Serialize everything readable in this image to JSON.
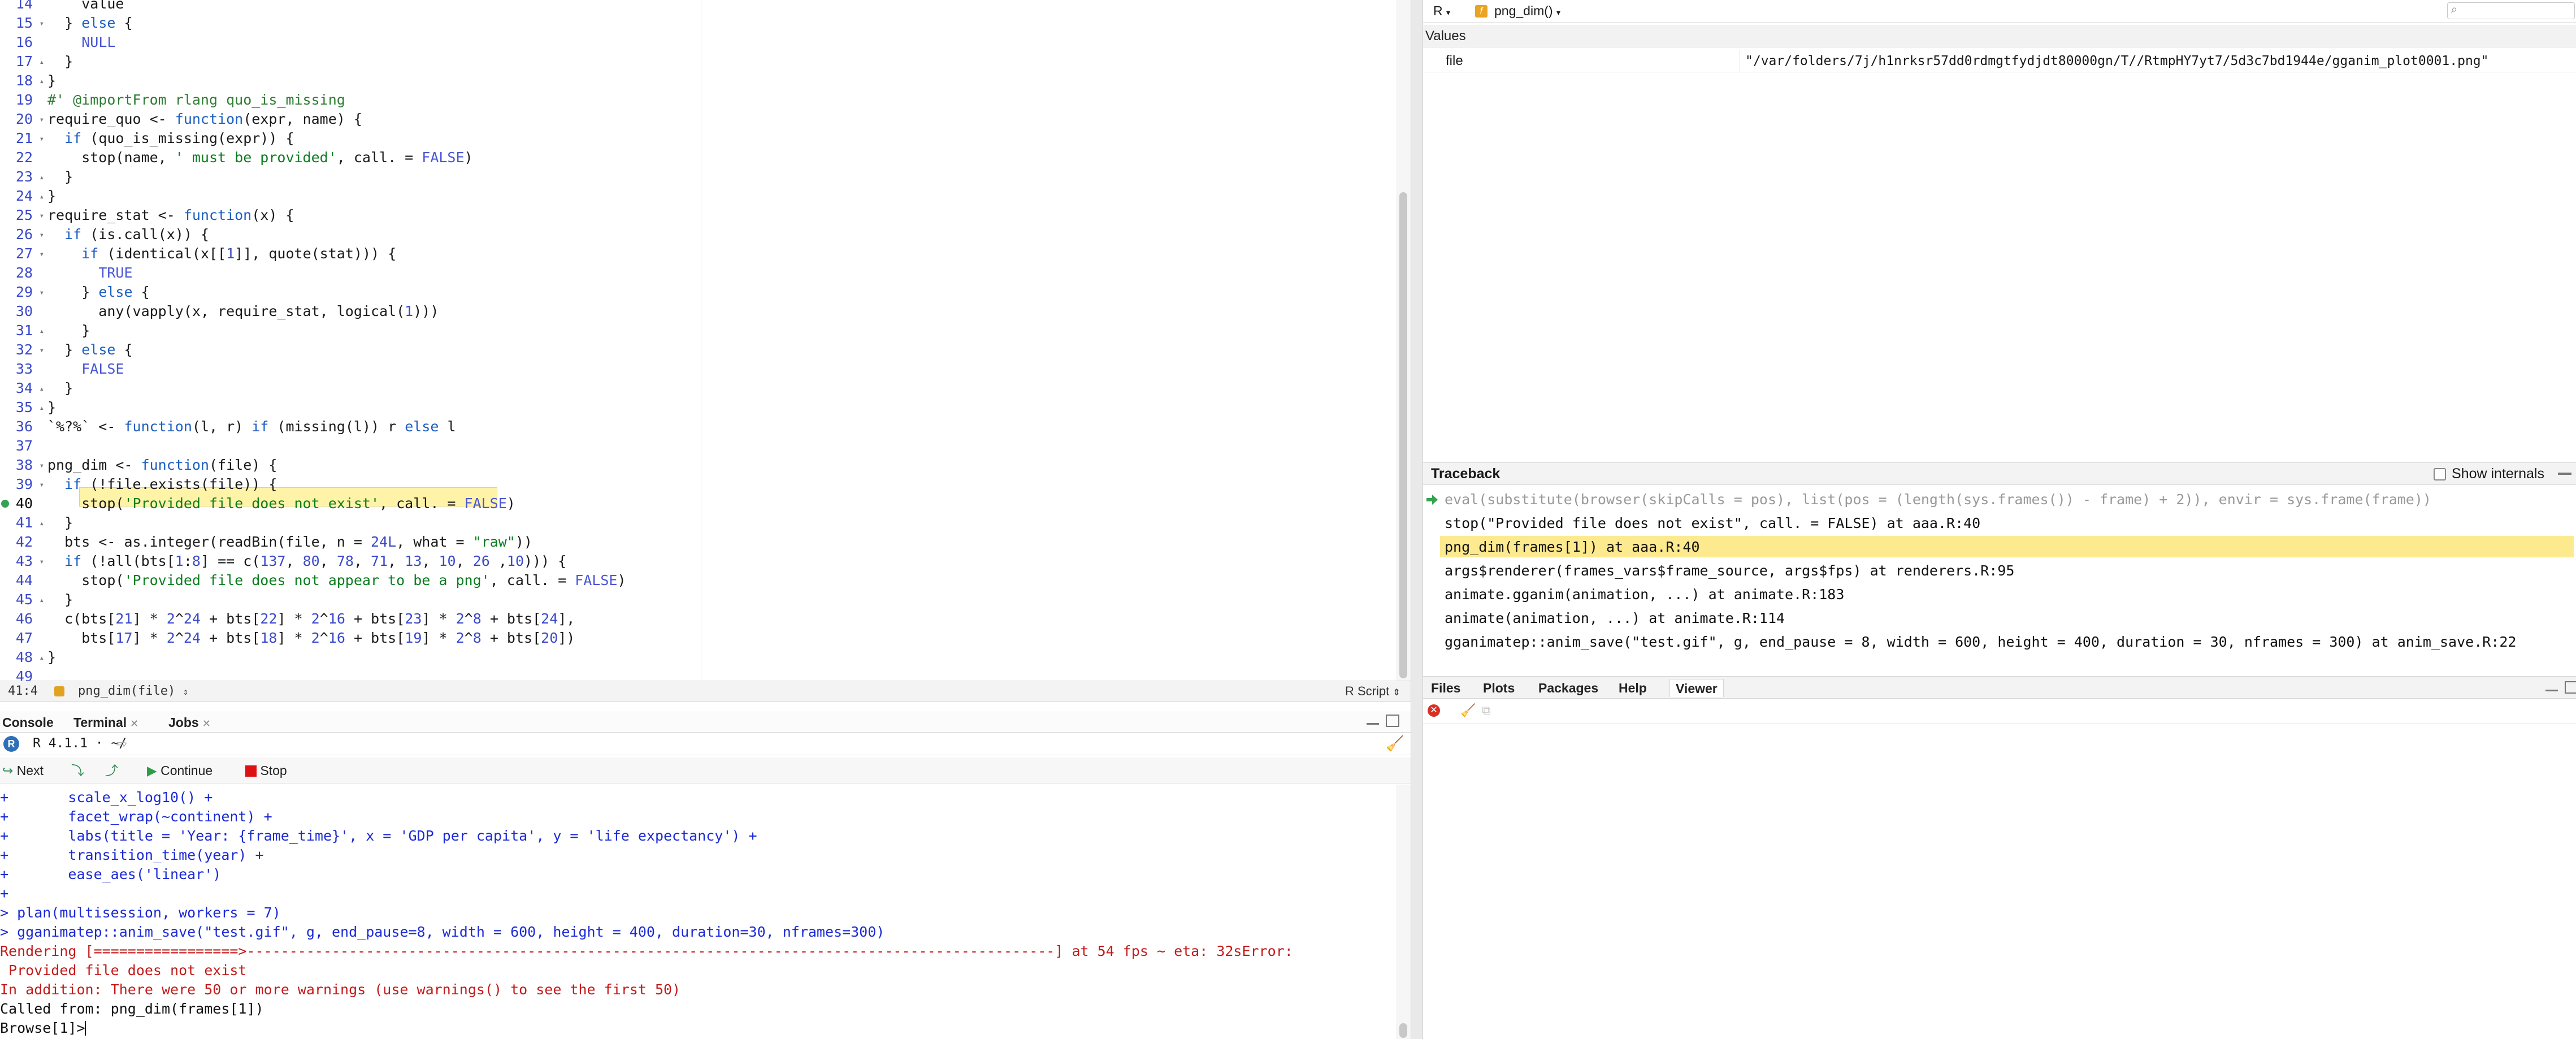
{
  "editor": {
    "lines": [
      {
        "n": "14",
        "fold": "",
        "code": [
          [
            "    value",
            "fn"
          ]
        ]
      },
      {
        "n": "15",
        "fold": "▾",
        "code": [
          [
            "  } ",
            "fn"
          ],
          [
            "else",
            "kw"
          ],
          [
            " {",
            "fn"
          ]
        ]
      },
      {
        "n": "16",
        "fold": "",
        "code": [
          [
            "    ",
            "fn"
          ],
          [
            "NULL",
            "lit"
          ]
        ]
      },
      {
        "n": "17",
        "fold": "▴",
        "code": [
          [
            "  }",
            "fn"
          ]
        ]
      },
      {
        "n": "18",
        "fold": "▴",
        "code": [
          [
            "}",
            "fn"
          ]
        ]
      },
      {
        "n": "19",
        "fold": "",
        "code": [
          [
            "#' @importFrom ",
            "comment"
          ],
          [
            "rlang quo_is_missing",
            "comment"
          ]
        ]
      },
      {
        "n": "20",
        "fold": "▾",
        "code": [
          [
            "require_quo <- ",
            "fn"
          ],
          [
            "function",
            "kw"
          ],
          [
            "(expr, name) {",
            "fn"
          ]
        ]
      },
      {
        "n": "21",
        "fold": "▾",
        "code": [
          [
            "  ",
            "fn"
          ],
          [
            "if",
            "kw"
          ],
          [
            " (quo_is_missing(expr)) {",
            "fn"
          ]
        ]
      },
      {
        "n": "22",
        "fold": "",
        "code": [
          [
            "    stop(name, ",
            "fn"
          ],
          [
            "' must be provided'",
            "str"
          ],
          [
            ", call. = ",
            "fn"
          ],
          [
            "FALSE",
            "lit"
          ],
          [
            ")",
            "fn"
          ]
        ]
      },
      {
        "n": "23",
        "fold": "▴",
        "code": [
          [
            "  }",
            "fn"
          ]
        ]
      },
      {
        "n": "24",
        "fold": "▴",
        "code": [
          [
            "}",
            "fn"
          ]
        ]
      },
      {
        "n": "25",
        "fold": "▾",
        "code": [
          [
            "require_stat <- ",
            "fn"
          ],
          [
            "function",
            "kw"
          ],
          [
            "(x) {",
            "fn"
          ]
        ]
      },
      {
        "n": "26",
        "fold": "▾",
        "code": [
          [
            "  ",
            "fn"
          ],
          [
            "if",
            "kw"
          ],
          [
            " (is.call(x)) {",
            "fn"
          ]
        ]
      },
      {
        "n": "27",
        "fold": "▾",
        "code": [
          [
            "    ",
            "fn"
          ],
          [
            "if",
            "kw"
          ],
          [
            " (identical(x[[",
            "fn"
          ],
          [
            "1",
            "num"
          ],
          [
            "]], quote(stat))) {",
            "fn"
          ]
        ]
      },
      {
        "n": "28",
        "fold": "",
        "code": [
          [
            "      ",
            "fn"
          ],
          [
            "TRUE",
            "lit"
          ]
        ]
      },
      {
        "n": "29",
        "fold": "▾",
        "code": [
          [
            "    } ",
            "fn"
          ],
          [
            "else",
            "kw"
          ],
          [
            " {",
            "fn"
          ]
        ]
      },
      {
        "n": "30",
        "fold": "",
        "code": [
          [
            "      any(vapply(x, require_stat, logical(",
            "fn"
          ],
          [
            "1",
            "num"
          ],
          [
            ")))",
            "fn"
          ]
        ]
      },
      {
        "n": "31",
        "fold": "▴",
        "code": [
          [
            "    }",
            "fn"
          ]
        ]
      },
      {
        "n": "32",
        "fold": "▾",
        "code": [
          [
            "  } ",
            "fn"
          ],
          [
            "else",
            "kw"
          ],
          [
            " {",
            "fn"
          ]
        ]
      },
      {
        "n": "33",
        "fold": "",
        "code": [
          [
            "    ",
            "fn"
          ],
          [
            "FALSE",
            "lit"
          ]
        ]
      },
      {
        "n": "34",
        "fold": "▴",
        "code": [
          [
            "  }",
            "fn"
          ]
        ]
      },
      {
        "n": "35",
        "fold": "▴",
        "code": [
          [
            "}",
            "fn"
          ]
        ]
      },
      {
        "n": "36",
        "fold": "",
        "code": [
          [
            "`%?%` <- ",
            "fn"
          ],
          [
            "function",
            "kw"
          ],
          [
            "(l, r) ",
            "fn"
          ],
          [
            "if",
            "kw"
          ],
          [
            " (missing(l)) r ",
            "fn"
          ],
          [
            "else",
            "kw"
          ],
          [
            " l",
            "fn"
          ]
        ]
      },
      {
        "n": "37",
        "fold": "",
        "code": []
      },
      {
        "n": "38",
        "fold": "▾",
        "code": [
          [
            "png_dim <- ",
            "fn"
          ],
          [
            "function",
            "kw"
          ],
          [
            "(file) {",
            "fn"
          ]
        ]
      },
      {
        "n": "39",
        "fold": "▾",
        "code": [
          [
            "  ",
            "fn"
          ],
          [
            "if",
            "kw"
          ],
          [
            " (!file.exists(file)) {",
            "fn"
          ]
        ]
      },
      {
        "n": "40",
        "fold": "",
        "code": [
          [
            "    stop(",
            "fn"
          ],
          [
            "'Provided file does not exist'",
            "str"
          ],
          [
            ", call. = ",
            "fn"
          ],
          [
            "FALSE",
            "lit"
          ],
          [
            ")",
            "fn"
          ]
        ]
      },
      {
        "n": "41",
        "fold": "▴",
        "code": [
          [
            "  }",
            "fn"
          ]
        ]
      },
      {
        "n": "42",
        "fold": "",
        "code": [
          [
            "  bts <- as.integer(readBin(file, n = ",
            "fn"
          ],
          [
            "24L",
            "num"
          ],
          [
            ", what = ",
            "fn"
          ],
          [
            "\"raw\"",
            "str"
          ],
          [
            "))",
            "fn"
          ]
        ]
      },
      {
        "n": "43",
        "fold": "▾",
        "code": [
          [
            "  ",
            "fn"
          ],
          [
            "if",
            "kw"
          ],
          [
            " (!all(bts[",
            "fn"
          ],
          [
            "1",
            "num"
          ],
          [
            ":",
            "fn"
          ],
          [
            "8",
            "num"
          ],
          [
            "] == c(",
            "fn"
          ],
          [
            "137",
            "num"
          ],
          [
            ", ",
            "fn"
          ],
          [
            "80",
            "num"
          ],
          [
            ", ",
            "fn"
          ],
          [
            "78",
            "num"
          ],
          [
            ", ",
            "fn"
          ],
          [
            "71",
            "num"
          ],
          [
            ", ",
            "fn"
          ],
          [
            "13",
            "num"
          ],
          [
            ", ",
            "fn"
          ],
          [
            "10",
            "num"
          ],
          [
            ", ",
            "fn"
          ],
          [
            "26",
            "num"
          ],
          [
            " ,",
            "fn"
          ],
          [
            "10",
            "num"
          ],
          [
            "))) {",
            "fn"
          ]
        ]
      },
      {
        "n": "44",
        "fold": "",
        "code": [
          [
            "    stop(",
            "fn"
          ],
          [
            "'Provided file does not appear to be a png'",
            "str"
          ],
          [
            ", call. = ",
            "fn"
          ],
          [
            "FALSE",
            "lit"
          ],
          [
            ")",
            "fn"
          ]
        ]
      },
      {
        "n": "45",
        "fold": "▴",
        "code": [
          [
            "  }",
            "fn"
          ]
        ]
      },
      {
        "n": "46",
        "fold": "",
        "code": [
          [
            "  c(bts[",
            "fn"
          ],
          [
            "21",
            "num"
          ],
          [
            "] * ",
            "fn"
          ],
          [
            "2",
            "num"
          ],
          [
            "^",
            "fn"
          ],
          [
            "24",
            "num"
          ],
          [
            " + bts[",
            "fn"
          ],
          [
            "22",
            "num"
          ],
          [
            "] * ",
            "fn"
          ],
          [
            "2",
            "num"
          ],
          [
            "^",
            "fn"
          ],
          [
            "16",
            "num"
          ],
          [
            " + bts[",
            "fn"
          ],
          [
            "23",
            "num"
          ],
          [
            "] * ",
            "fn"
          ],
          [
            "2",
            "num"
          ],
          [
            "^",
            "fn"
          ],
          [
            "8",
            "num"
          ],
          [
            " + bts[",
            "fn"
          ],
          [
            "24",
            "num"
          ],
          [
            "],",
            "fn"
          ]
        ]
      },
      {
        "n": "47",
        "fold": "",
        "code": [
          [
            "    bts[",
            "fn"
          ],
          [
            "17",
            "num"
          ],
          [
            "] * ",
            "fn"
          ],
          [
            "2",
            "num"
          ],
          [
            "^",
            "fn"
          ],
          [
            "24",
            "num"
          ],
          [
            " + bts[",
            "fn"
          ],
          [
            "18",
            "num"
          ],
          [
            "] * ",
            "fn"
          ],
          [
            "2",
            "num"
          ],
          [
            "^",
            "fn"
          ],
          [
            "16",
            "num"
          ],
          [
            " + bts[",
            "fn"
          ],
          [
            "19",
            "num"
          ],
          [
            "] * ",
            "fn"
          ],
          [
            "2",
            "num"
          ],
          [
            "^",
            "fn"
          ],
          [
            "8",
            "num"
          ],
          [
            " + bts[",
            "fn"
          ],
          [
            "20",
            "num"
          ],
          [
            "])",
            "fn"
          ]
        ]
      },
      {
        "n": "48",
        "fold": "▴",
        "code": [
          [
            "}",
            "fn"
          ]
        ]
      },
      {
        "n": "49",
        "fold": "",
        "code": []
      }
    ],
    "current_line": "40"
  },
  "statusbar": {
    "position": "41:4",
    "function": "png_dim(file)",
    "file_type": "R Script"
  },
  "console": {
    "tabs": [
      "Console",
      "Terminal",
      "Jobs"
    ],
    "r_version": "R 4.1.1 · ~/",
    "debug_buttons": {
      "next": "Next",
      "continue": "Continue",
      "stop": "Stop"
    },
    "lines": [
      {
        "text": "+       scale_x_log10() +",
        "color": "blue"
      },
      {
        "text": "+       facet_wrap(~continent) +",
        "color": "blue"
      },
      {
        "text": "+       labs(title = 'Year: {frame_time}', x = 'GDP per capita', y = 'life expectancy') +",
        "color": "blue"
      },
      {
        "text": "+       transition_time(year) +",
        "color": "blue"
      },
      {
        "text": "+       ease_aes('linear')",
        "color": "blue"
      },
      {
        "text": "+",
        "color": "blue"
      },
      {
        "text": "> plan(multisession, workers = 7)",
        "color": "blue"
      },
      {
        "text": "> gganimatep::anim_save(\"test.gif\", g, end_pause=8, width = 600, height = 400, duration=30, nframes=300)",
        "color": "blue"
      },
      {
        "text": "Rendering [=================>-----------------------------------------------------------------------------------------------] at 54 fps ~ eta: 32sError:",
        "color": "red"
      },
      {
        "text": " Provided file does not exist",
        "color": "red"
      },
      {
        "text": "In addition: There were 50 or more warnings (use warnings() to see the first 50)",
        "color": "red"
      },
      {
        "text": "Called from: png_dim(frames[1])",
        "color": "black"
      },
      {
        "text": "Browse[1]> ",
        "color": "black"
      }
    ]
  },
  "environment": {
    "language": "R",
    "scope": "png_dim()",
    "values_label": "Values",
    "rows": [
      {
        "name": "file",
        "value": "\"/var/folders/7j/h1nrksr57dd0rdmgtfydjdt80000gn/T//RtmpHY7yt7/5d3c7bd1944e/gganim_plot0001.png\""
      }
    ]
  },
  "traceback": {
    "title": "Traceback",
    "show_internals": "Show internals",
    "lines": [
      {
        "text": "eval(substitute(browser(skipCalls = pos), list(pos = (length(sys.frames()) - frame) + 2)), envir = sys.frame(frame))",
        "style": "dim"
      },
      {
        "text": "stop(\"Provided file does not exist\", call. = FALSE) at aaa.R:40",
        "style": "normal"
      },
      {
        "text": "png_dim(frames[1]) at aaa.R:40",
        "style": "highlight"
      },
      {
        "text": "args$renderer(frames_vars$frame_source, args$fps) at renderers.R:95",
        "style": "normal"
      },
      {
        "text": "animate.gganim(animation, ...) at animate.R:183",
        "style": "normal"
      },
      {
        "text": "animate(animation, ...) at animate.R:114",
        "style": "normal"
      },
      {
        "text": "gganimatep::anim_save(\"test.gif\", g, end_pause = 8, width = 600, height = 400, duration = 30, nframes = 300) at anim_save.R:22",
        "style": "normal"
      }
    ]
  },
  "files_pane": {
    "tabs": [
      "Files",
      "Plots",
      "Packages",
      "Help",
      "Viewer"
    ]
  }
}
